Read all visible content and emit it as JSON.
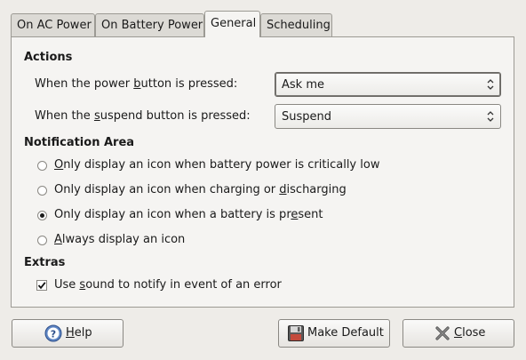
{
  "tabs": [
    {
      "label": "On AC Power"
    },
    {
      "label": "On Battery Power"
    },
    {
      "label": "General"
    },
    {
      "label": "Scheduling"
    }
  ],
  "actions": {
    "heading": "Actions",
    "power_label_pre": "When the power ",
    "power_label_ul": "b",
    "power_label_post": "utton is pressed:",
    "power_value": "Ask me",
    "suspend_label_pre": "When the ",
    "suspend_label_ul": "s",
    "suspend_label_post": "uspend button is pressed:",
    "suspend_value": "Suspend"
  },
  "notification": {
    "heading": "Notification Area",
    "options": [
      {
        "pre": "",
        "ul": "O",
        "post": "nly display an icon when battery power is critically low",
        "selected": false
      },
      {
        "pre": "Only display an icon when charging or ",
        "ul": "d",
        "post": "ischarging",
        "selected": false
      },
      {
        "pre": "Only display an icon when a battery is pr",
        "ul": "e",
        "post": "sent",
        "selected": true
      },
      {
        "pre": "",
        "ul": "A",
        "post": "lways display an icon",
        "selected": false
      }
    ]
  },
  "extras": {
    "heading": "Extras",
    "sound_pre": "Use ",
    "sound_ul": "s",
    "sound_post": "ound to notify in event of an error",
    "sound_checked": true
  },
  "buttons": {
    "help_ul": "H",
    "help_post": "elp",
    "default_label": "Make Default",
    "close_ul": "C",
    "close_post": "lose"
  },
  "icons": {
    "help": "help-icon",
    "default": "save-disk-icon",
    "close": "close-x-icon"
  }
}
